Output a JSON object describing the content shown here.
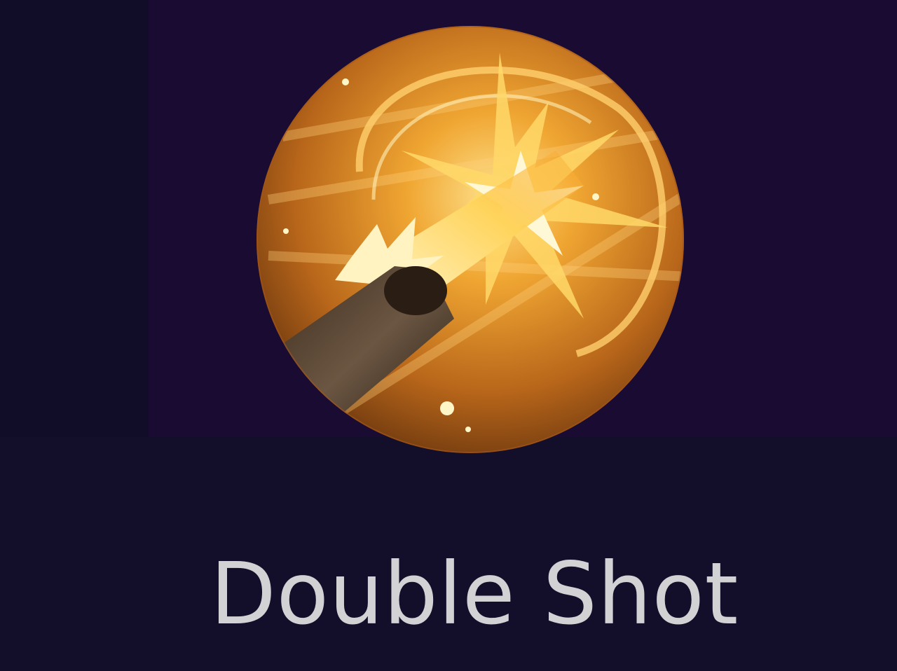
{
  "skill": {
    "name": "Double Shot",
    "icon": "double-shot-icon"
  },
  "colors": {
    "background": "#130e29",
    "top_panel": "#190b31",
    "left_strip": "#110d29",
    "label": "#d2d2d5",
    "icon_gold": "#f3a52a",
    "icon_dark": "#6a3a0f"
  }
}
